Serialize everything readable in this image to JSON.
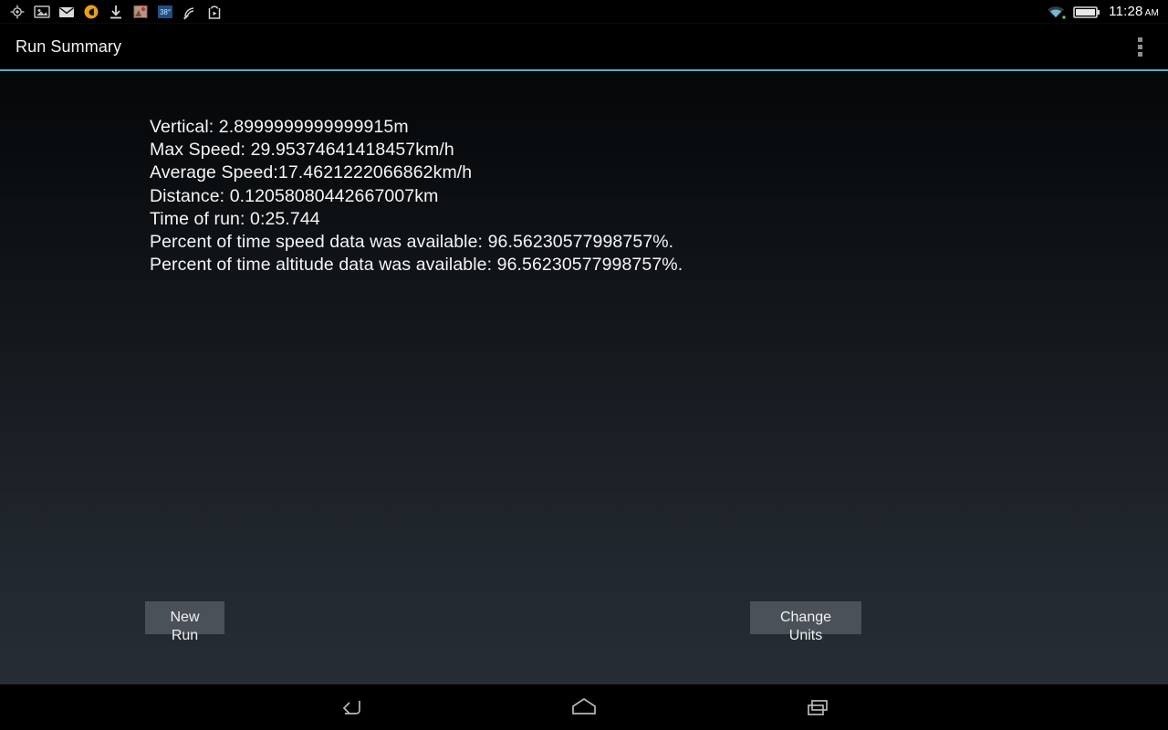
{
  "statusbar": {
    "icons": [
      {
        "name": "location-icon",
        "label": "GPS location"
      },
      {
        "name": "photo-icon",
        "label": "Gallery image"
      },
      {
        "name": "mail-icon",
        "label": "Email"
      },
      {
        "name": "browser-icon",
        "label": "Browser update"
      },
      {
        "name": "download-icon",
        "label": "Download complete"
      },
      {
        "name": "news-icon",
        "label": "News app"
      },
      {
        "name": "weather-icon",
        "label": "38°"
      },
      {
        "name": "network-icon",
        "label": "Network activity"
      },
      {
        "name": "play-store-icon",
        "label": "Play Store"
      }
    ],
    "weather_temp": "38°",
    "wifi_icon": "wifi-icon",
    "battery_icon": "battery-icon",
    "clock_time": "11:28",
    "clock_ampm": "AM"
  },
  "actionbar": {
    "title": "Run Summary",
    "overflow_name": "overflow-menu-icon",
    "divider_color": "#5badd0"
  },
  "main": {
    "stats": [
      "Vertical: 2.8999999999999915m",
      "Max Speed: 29.95374641418457km/h",
      "Average Speed:17.4621222066862km/h",
      "Distance: 0.12058080442667007km",
      "Time of run: 0:25.744",
      "Percent of time speed data was available: 96.56230577998757%.",
      "Percent of time altitude data was available: 96.56230577998757%."
    ],
    "values": {
      "vertical_m": "2.8999999999999915",
      "max_speed_kmh": "29.95374641418457",
      "average_speed_kmh": "17.4621222066862",
      "distance_km": "0.12058080442667007",
      "time_of_run": "0:25.744",
      "percent_speed_available": "96.56230577998757",
      "percent_altitude_available": "96.56230577998757"
    },
    "buttons": {
      "new_run": "New Run",
      "change_units": "Change Units"
    },
    "button_color": "#4b5158"
  },
  "navbar": {
    "back": "back-icon",
    "home": "home-icon",
    "recents": "recents-icon"
  }
}
